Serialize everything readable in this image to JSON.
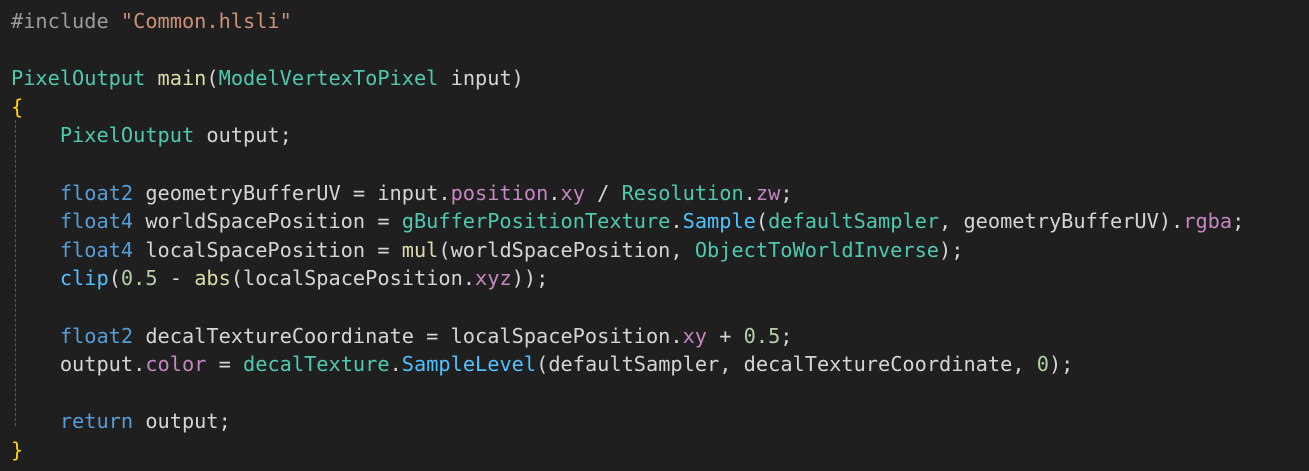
{
  "editor": {
    "language": "HLSL",
    "colors": {
      "background": "#1f1f1f",
      "preprocessor": "#9b9b9b",
      "string": "#ce9178",
      "type": "#4ec9b0",
      "keyword": "#569cd6",
      "function": "#dcdcaa",
      "intrinsic": "#4fc1ff",
      "member": "#c586c0",
      "number": "#b5cea8",
      "identifier": "#d4d4d4",
      "brace": "#ffd700"
    },
    "lines": [
      [
        {
          "t": "#include ",
          "k": "preproc"
        },
        {
          "t": "\"Common.hlsli\"",
          "k": "string"
        }
      ],
      [],
      [
        {
          "t": "PixelOutput",
          "k": "type"
        },
        {
          "t": " ",
          "k": "punct"
        },
        {
          "t": "main",
          "k": "func"
        },
        {
          "t": "(",
          "k": "punct"
        },
        {
          "t": "ModelVertexToPixel",
          "k": "type"
        },
        {
          "t": " input",
          "k": "ident"
        },
        {
          "t": ")",
          "k": "punct"
        }
      ],
      [
        {
          "t": "{",
          "k": "brace"
        }
      ],
      [
        {
          "t": "    ",
          "k": "punct"
        },
        {
          "t": "PixelOutput",
          "k": "type"
        },
        {
          "t": " output;",
          "k": "ident"
        }
      ],
      [],
      [
        {
          "t": "    ",
          "k": "punct"
        },
        {
          "t": "float2",
          "k": "keyword"
        },
        {
          "t": " geometryBufferUV = input",
          "k": "ident"
        },
        {
          "t": ".",
          "k": "punct"
        },
        {
          "t": "position",
          "k": "member"
        },
        {
          "t": ".",
          "k": "punct"
        },
        {
          "t": "xy",
          "k": "member"
        },
        {
          "t": " / ",
          "k": "op"
        },
        {
          "t": "Resolution",
          "k": "type"
        },
        {
          "t": ".",
          "k": "punct"
        },
        {
          "t": "zw",
          "k": "member"
        },
        {
          "t": ";",
          "k": "punct"
        }
      ],
      [
        {
          "t": "    ",
          "k": "punct"
        },
        {
          "t": "float4",
          "k": "keyword"
        },
        {
          "t": " worldSpacePosition = ",
          "k": "ident"
        },
        {
          "t": "gBufferPositionTexture",
          "k": "type"
        },
        {
          "t": ".",
          "k": "punct"
        },
        {
          "t": "Sample",
          "k": "intrinsic"
        },
        {
          "t": "(",
          "k": "punct"
        },
        {
          "t": "defaultSampler",
          "k": "type"
        },
        {
          "t": ", geometryBufferUV)",
          "k": "ident"
        },
        {
          "t": ".",
          "k": "punct"
        },
        {
          "t": "rgba",
          "k": "member"
        },
        {
          "t": ";",
          "k": "punct"
        }
      ],
      [
        {
          "t": "    ",
          "k": "punct"
        },
        {
          "t": "float4",
          "k": "keyword"
        },
        {
          "t": " localSpacePosition = ",
          "k": "ident"
        },
        {
          "t": "mul",
          "k": "func"
        },
        {
          "t": "(worldSpacePosition, ",
          "k": "ident"
        },
        {
          "t": "ObjectToWorldInverse",
          "k": "type"
        },
        {
          "t": ");",
          "k": "punct"
        }
      ],
      [
        {
          "t": "    ",
          "k": "punct"
        },
        {
          "t": "clip",
          "k": "intrinsic"
        },
        {
          "t": "(",
          "k": "punct"
        },
        {
          "t": "0.5",
          "k": "number"
        },
        {
          "t": " - ",
          "k": "op"
        },
        {
          "t": "abs",
          "k": "func"
        },
        {
          "t": "(localSpacePosition",
          "k": "ident"
        },
        {
          "t": ".",
          "k": "punct"
        },
        {
          "t": "xyz",
          "k": "member"
        },
        {
          "t": "));",
          "k": "punct"
        }
      ],
      [],
      [
        {
          "t": "    ",
          "k": "punct"
        },
        {
          "t": "float2",
          "k": "keyword"
        },
        {
          "t": " decalTextureCoordinate = localSpacePosition",
          "k": "ident"
        },
        {
          "t": ".",
          "k": "punct"
        },
        {
          "t": "xy",
          "k": "member"
        },
        {
          "t": " + ",
          "k": "op"
        },
        {
          "t": "0.5",
          "k": "number"
        },
        {
          "t": ";",
          "k": "punct"
        }
      ],
      [
        {
          "t": "    ",
          "k": "punct"
        },
        {
          "t": "output",
          "k": "ident"
        },
        {
          "t": ".",
          "k": "punct"
        },
        {
          "t": "color",
          "k": "member"
        },
        {
          "t": " = ",
          "k": "op"
        },
        {
          "t": "decalTexture",
          "k": "type"
        },
        {
          "t": ".",
          "k": "punct"
        },
        {
          "t": "SampleLevel",
          "k": "intrinsic"
        },
        {
          "t": "(defaultSampler, decalTextureCoordinate, ",
          "k": "ident"
        },
        {
          "t": "0",
          "k": "number"
        },
        {
          "t": ");",
          "k": "punct"
        }
      ],
      [],
      [
        {
          "t": "    ",
          "k": "punct"
        },
        {
          "t": "return",
          "k": "keyword"
        },
        {
          "t": " output;",
          "k": "ident"
        }
      ],
      [
        {
          "t": "}",
          "k": "brace"
        }
      ]
    ]
  }
}
